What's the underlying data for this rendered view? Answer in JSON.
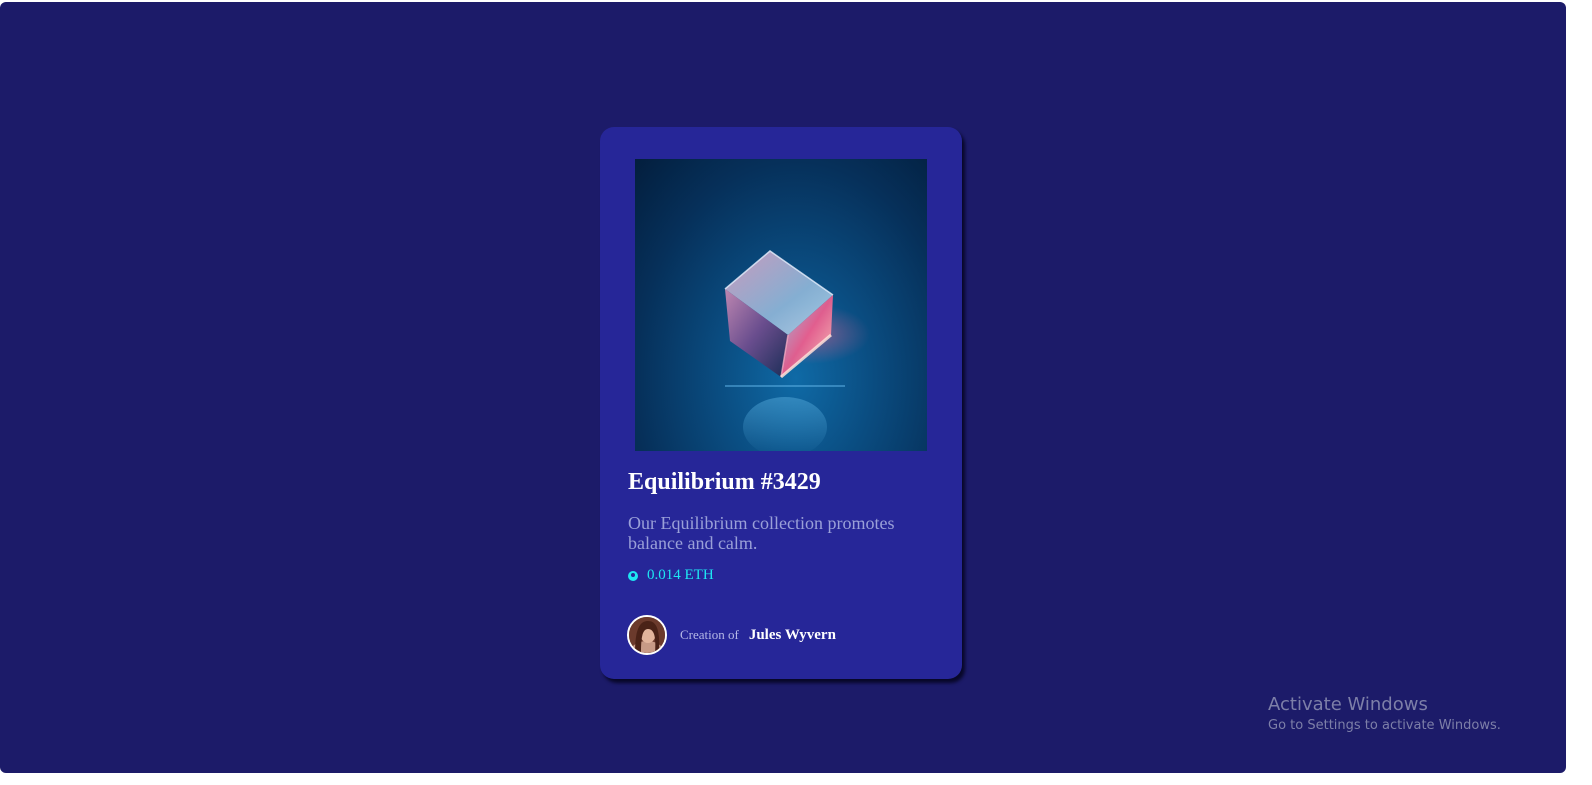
{
  "card": {
    "title": "Equilibrium #3429",
    "description": "Our Equilibrium collection promotes balance and calm.",
    "price": "0.014 ETH",
    "creation_label": "Creation of",
    "creator_name": "Jules Wyvern"
  },
  "watermark": {
    "title": "Activate Windows",
    "subtitle": "Go to Settings to activate Windows."
  },
  "colors": {
    "page_background": "#1c1b69",
    "card_background": "#262698",
    "accent_cyan": "#1ee6f2",
    "description_text": "#9aa0d8"
  },
  "icons": {
    "price": "ethereum-icon"
  }
}
